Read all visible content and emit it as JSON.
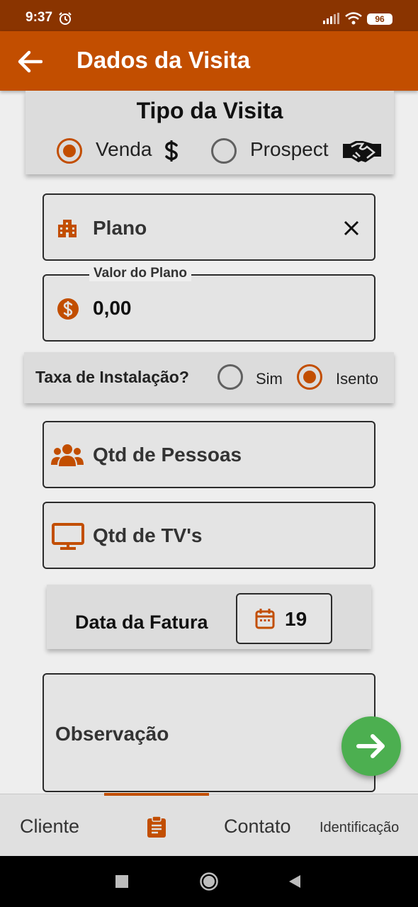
{
  "status_bar": {
    "time": "9:37",
    "battery": "96"
  },
  "app_bar": {
    "title": "Dados da Visita"
  },
  "tipo_visita": {
    "title": "Tipo da Visita",
    "options": [
      {
        "label": "Venda",
        "selected": true,
        "icon": "dollar-icon"
      },
      {
        "label": "Prospect",
        "selected": false,
        "icon": "handshake-icon"
      }
    ]
  },
  "plano": {
    "label": "Plano",
    "icon": "building-icon",
    "clear_icon": "close-icon"
  },
  "valor_plano": {
    "legend": "Valor do Plano",
    "value": "0,00",
    "icon": "dollar-circle-icon"
  },
  "taxa_instalacao": {
    "question": "Taxa de Instalação?",
    "options": [
      {
        "label": "Sim",
        "selected": false
      },
      {
        "label": "Isento",
        "selected": true
      }
    ]
  },
  "qtd_pessoas": {
    "label": "Qtd de Pessoas",
    "icon": "people-icon"
  },
  "qtd_tvs": {
    "label": "Qtd de TV's",
    "icon": "tv-icon"
  },
  "data_fatura": {
    "label": "Data da Fatura",
    "value": "19",
    "icon": "calendar-icon"
  },
  "observacao": {
    "label": "Observação"
  },
  "fab": {
    "icon": "arrow-right-icon"
  },
  "bottom_nav": {
    "tabs": [
      {
        "label": "Cliente",
        "active": false
      },
      {
        "label": "",
        "icon": "clipboard-icon",
        "active": true
      },
      {
        "label": "Contato",
        "active": false
      },
      {
        "label": "Identificação",
        "active": false
      }
    ]
  },
  "colors": {
    "primary": "#c24e00",
    "status_bar": "#8a3400",
    "fab": "#4caf50"
  }
}
